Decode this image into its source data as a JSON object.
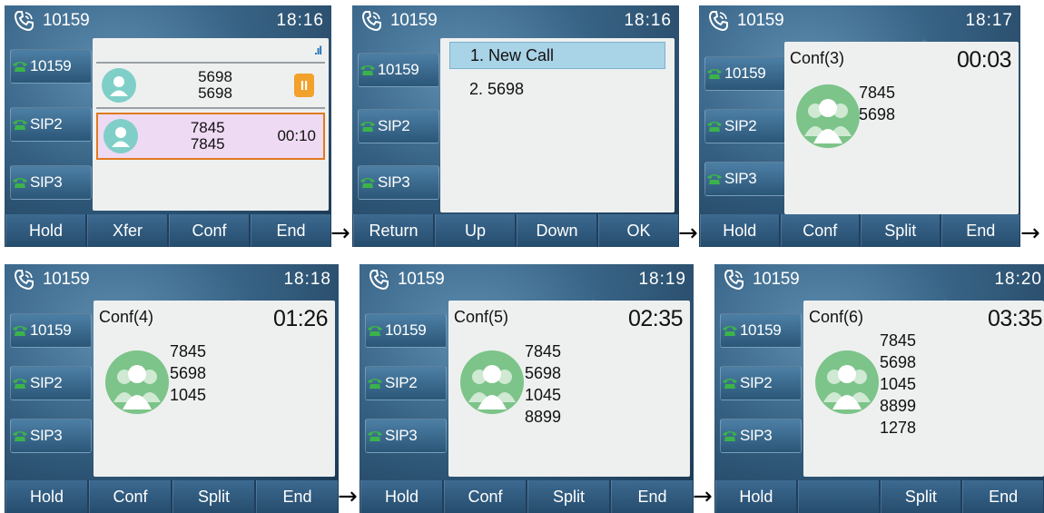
{
  "screens": [
    {
      "account": "10159",
      "time": "18:16",
      "lines": [
        "10159",
        "SIP2",
        "SIP3"
      ],
      "calls": [
        {
          "name": "5698",
          "number": "5698",
          "status": "held",
          "hold_label": "II"
        },
        {
          "name": "7845",
          "number": "7845",
          "duration": "00:10",
          "status": "active"
        }
      ],
      "softkeys": [
        "Hold",
        "Xfer",
        "Conf",
        "End"
      ]
    },
    {
      "account": "10159",
      "time": "18:16",
      "lines": [
        "10159",
        "SIP2",
        "SIP3"
      ],
      "menu": [
        "1. New Call",
        "2. 5698"
      ],
      "menu_selected": 0,
      "softkeys": [
        "Return",
        "Up",
        "Down",
        "OK"
      ]
    },
    {
      "account": "10159",
      "time": "18:17",
      "lines": [
        "10159",
        "SIP2",
        "SIP3"
      ],
      "conf_title": "Conf(3)",
      "conf_timer": "00:03",
      "members": [
        "7845",
        "5698"
      ],
      "softkeys": [
        "Hold",
        "Conf",
        "Split",
        "End"
      ]
    },
    {
      "account": "10159",
      "time": "18:18",
      "lines": [
        "10159",
        "SIP2",
        "SIP3"
      ],
      "conf_title": "Conf(4)",
      "conf_timer": "01:26",
      "members": [
        "7845",
        "5698",
        "1045"
      ],
      "softkeys": [
        "Hold",
        "Conf",
        "Split",
        "End"
      ]
    },
    {
      "account": "10159",
      "time": "18:19",
      "lines": [
        "10159",
        "SIP2",
        "SIP3"
      ],
      "conf_title": "Conf(5)",
      "conf_timer": "02:35",
      "members": [
        "7845",
        "5698",
        "1045",
        "8899"
      ],
      "softkeys": [
        "Hold",
        "Conf",
        "Split",
        "End"
      ]
    },
    {
      "account": "10159",
      "time": "18:20",
      "lines": [
        "10159",
        "SIP2",
        "SIP3"
      ],
      "conf_title": "Conf(6)",
      "conf_timer": "03:35",
      "members": [
        "7845",
        "5698",
        "1045",
        "8899",
        "1278"
      ],
      "softkeys": [
        "Hold",
        "",
        "Split",
        "End"
      ]
    }
  ],
  "arrow": "→",
  "signal_label": ".ıl",
  "colors": {
    "accent_orange": "#e07a20",
    "hold_orange": "#f2a12a",
    "menu_highlight": "#a9d3e6",
    "avatar_green": "#7cc489"
  }
}
